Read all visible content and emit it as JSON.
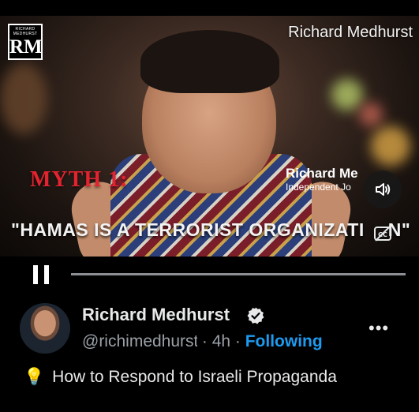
{
  "video": {
    "logo_small": "RICHARD MEDHURST",
    "logo_big": "RM",
    "watermark": "Richard Medhurst",
    "myth_caption": "MYTH 1:",
    "lower_third_name": "Richard Me",
    "lower_third_subtitle": "Independent Jo",
    "quote_caption": "\"HAMAS IS A TERRORIST ORGANIZATI",
    "quote_end": "N\"",
    "volume_icon": "speaker-icon",
    "captions_icon": "closed-captions-icon"
  },
  "player": {
    "state": "playing",
    "pause_icon": "pause-icon",
    "progress_fraction": 0.0
  },
  "post": {
    "author_name": "Richard Medhurst",
    "verified": true,
    "handle": "@richimedhurst",
    "separator": "·",
    "time": "4h",
    "following_label": "Following",
    "more_label": "•••",
    "emoji": "💡",
    "text": "How to Respond to Israeli Propaganda"
  },
  "colors": {
    "background": "#000000",
    "accent": "#1d9bf0",
    "myth_red": "#e3232f",
    "muted_text": "#9aa0a6"
  }
}
